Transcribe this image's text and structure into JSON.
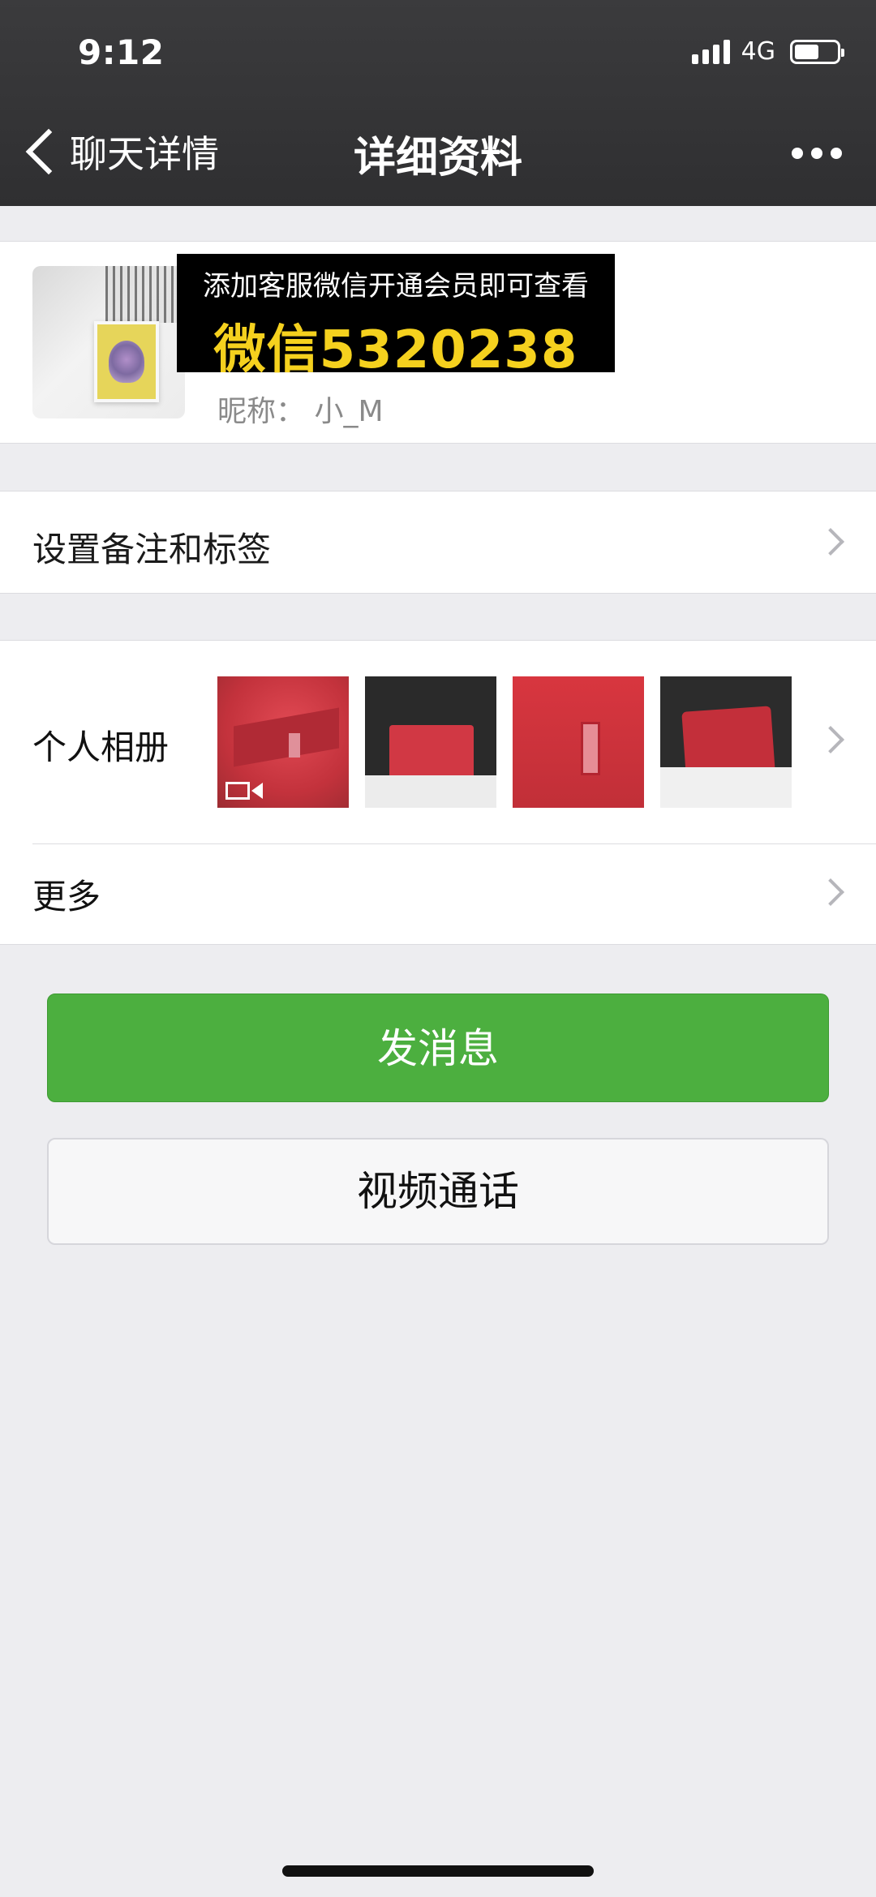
{
  "status_bar": {
    "time": "9:12",
    "network": "4G"
  },
  "nav": {
    "back_label": "聊天详情",
    "title": "详细资料"
  },
  "profile": {
    "nickname": "昵称：  小_M",
    "promo": {
      "line1": "添加客服微信开通会员即可查看",
      "line2": "微信5320238"
    }
  },
  "rows": {
    "remark_label": "设置备注和标签",
    "album_label": "个人相册",
    "more_label": "更多"
  },
  "buttons": {
    "message": "发消息",
    "video_call": "视频通话"
  },
  "colors": {
    "header_bg": "#333335",
    "primary_green": "#4caf3f",
    "page_bg": "#ededf0",
    "promo_yellow": "#f5d11e"
  },
  "icons": [
    "signal-icon",
    "battery-icon",
    "back-chevron-icon",
    "more-dots-icon",
    "chevron-right-icon",
    "video-icon"
  ]
}
